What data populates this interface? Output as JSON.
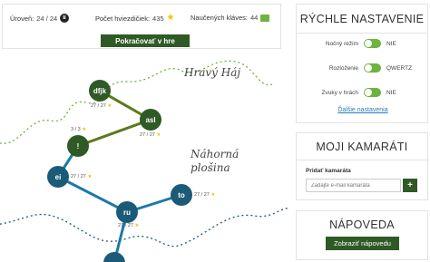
{
  "topbar": {
    "level_label": "Úroveň:",
    "level_value": "24 / 24",
    "stars_label": "Počet hviezdičiek:",
    "stars_value": "435",
    "keys_label": "Naučených kláves:",
    "keys_value": "44",
    "continue_label": "Pokračovať v hre"
  },
  "map": {
    "region_labels": [
      "Hravý Háj",
      "Náhorná",
      "plošina"
    ],
    "nodes": [
      {
        "label": "dfjk",
        "score": "27 / 27",
        "color": "#2f5a26"
      },
      {
        "label": "asl",
        "score": "27 / 27",
        "color": "#2f5a26"
      },
      {
        "label": "!",
        "score": "3 / 3",
        "color": "#2f5a26"
      },
      {
        "label": "ei",
        "score": "27 / 27",
        "color": "#1b5b78"
      },
      {
        "label": "ru",
        "score": "27 / 27",
        "color": "#1b5b78"
      },
      {
        "label": "to",
        "score": "27 / 27",
        "color": "#1b5b78"
      },
      {
        "label": "",
        "score": "",
        "color": "#1b5b78"
      }
    ]
  },
  "quick_settings": {
    "title": "RÝCHLE NASTAVENIE",
    "rows": [
      {
        "label": "Nočný režim",
        "state": "NIE"
      },
      {
        "label": "Rozloženie",
        "state": "QWERTZ"
      },
      {
        "label": "Zvuky v hrách",
        "state": "NIE"
      }
    ],
    "more_link": "Ďalšie nastavenia"
  },
  "friends": {
    "title": "MOJI KAMARÁTI",
    "add_label": "Pridať kamaráta",
    "email_placeholder": "Zadajte e-mail kamaráta",
    "add_button": "+"
  },
  "help": {
    "title": "NÁPOVEDA",
    "button": "Zobraziť nápovedu"
  },
  "colors": {
    "accent_dark_green": "#2f5a26",
    "toggle_green": "#6cb33f",
    "path_blue": "#1b5b78",
    "star_yellow": "#f2c200",
    "link_blue": "#2a7ab8"
  }
}
